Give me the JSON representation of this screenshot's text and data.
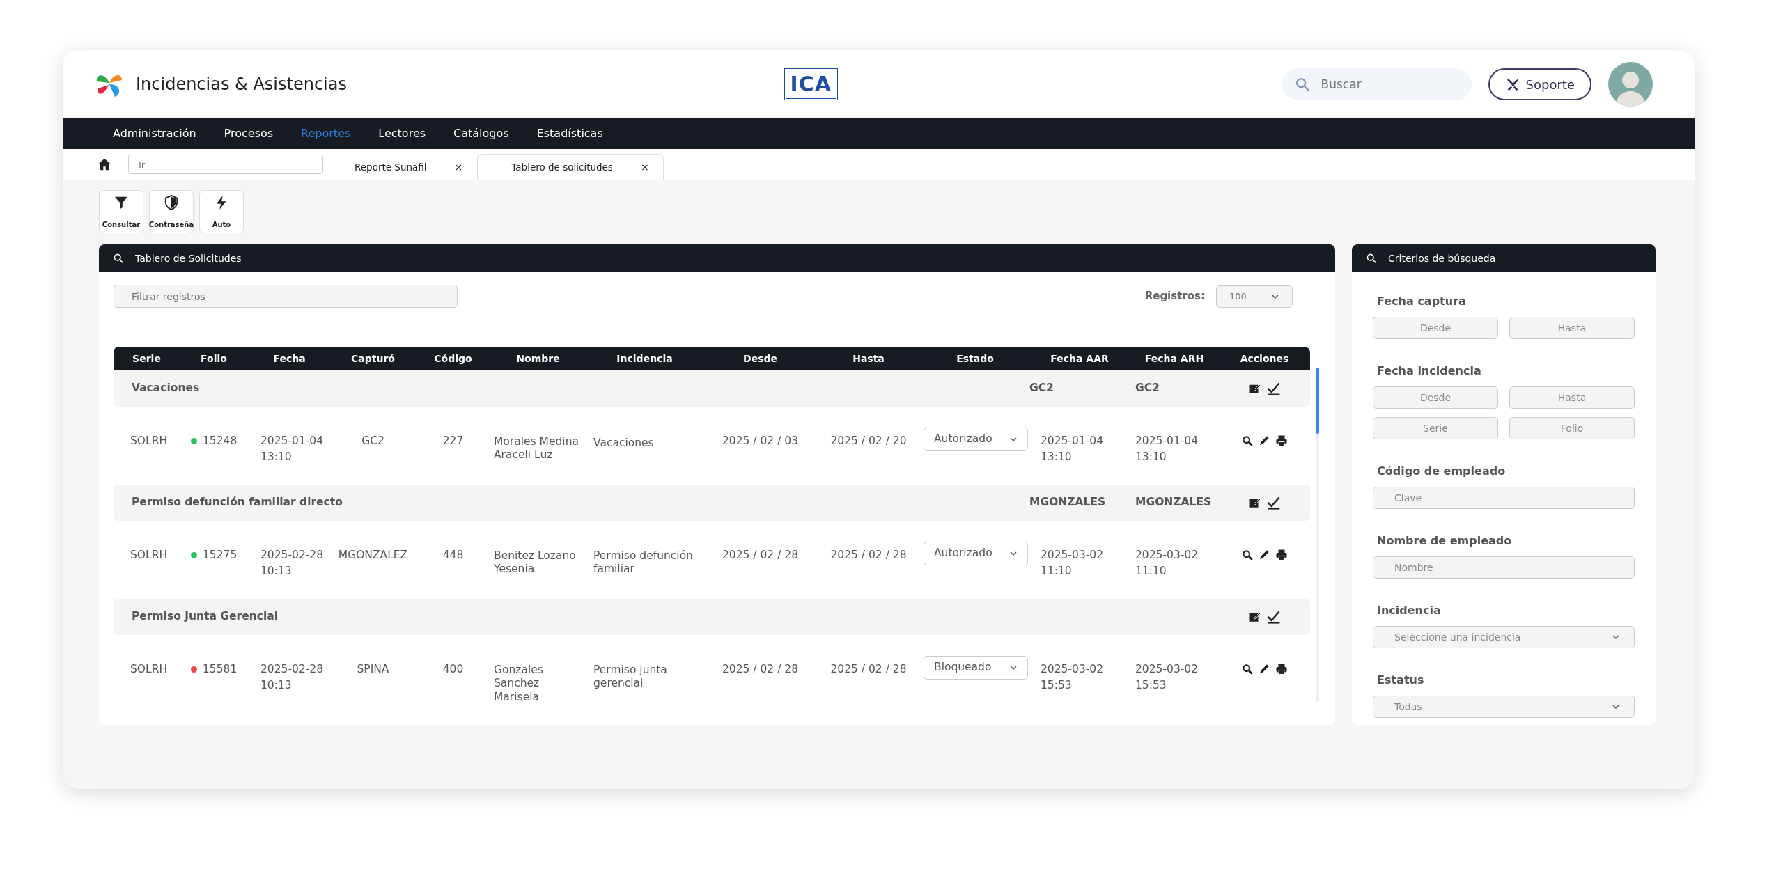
{
  "app": {
    "title": "Incidencias & Asistencias",
    "logo_text": "ICA",
    "search": {
      "placeholder": "Buscar"
    },
    "support_button": "Soporte"
  },
  "menu": [
    {
      "label": "Administración",
      "selected": false
    },
    {
      "label": "Procesos",
      "selected": false
    },
    {
      "label": "Reportes",
      "selected": true
    },
    {
      "label": "Lectores",
      "selected": false
    },
    {
      "label": "Catálogos",
      "selected": false
    },
    {
      "label": "Estadísticas",
      "selected": false
    }
  ],
  "tabbar": {
    "go_field": {
      "placeholder": "Ir"
    },
    "tabs": [
      {
        "label": "Reporte Sunafil",
        "close": "×",
        "selected": false
      },
      {
        "label": "Tablero de solicitudes",
        "close": "×",
        "selected": true
      }
    ]
  },
  "toolbar": [
    {
      "kind": "funnel",
      "label": "Consultar"
    },
    {
      "kind": "shield",
      "label": "Contraseña"
    },
    {
      "kind": "bolt",
      "label": "Auto"
    }
  ],
  "main_panel": {
    "title": "Tablero de Solicitudes",
    "filter": {
      "placeholder": "Filtrar registros"
    },
    "records_label": "Registros:",
    "records_value": "100",
    "table": {
      "columns": [
        "Serie",
        "Folio",
        "Fecha",
        "Capturó",
        "Código",
        "Nombre",
        "Incidencia",
        "Desde",
        "Hasta",
        "Estado",
        "Fecha AAR",
        "Fecha ARH",
        "Acciones"
      ],
      "groups": [
        {
          "title": "Vacaciones",
          "fecha_aar": "GC2",
          "fecha_arh": "GC2",
          "rows": [
            {
              "serie": "SOLRH",
              "folio": "15248",
              "color": "#22c55e",
              "fecha": "2025-01-04 13:10",
              "capturo": "GC2",
              "codigo": "227",
              "nombre": "Morales Medina Araceli Luz",
              "incidencia": "Vacaciones",
              "desde": "2025 / 02 / 03",
              "hasta": "2025 / 02 / 20",
              "estado": "Autorizado",
              "fecha_aar": "2025-01-04 13:10",
              "fecha_arh": "2025-01-04 13:10"
            }
          ]
        },
        {
          "title": "Permiso defunción familiar directo",
          "fecha_aar": "MGONZALES",
          "fecha_arh": "MGONZALES",
          "rows": [
            {
              "serie": "SOLRH",
              "folio": "15275",
              "color": "#22c55e",
              "fecha": "2025-02-28 10:13",
              "capturo": "MGONZALEZ",
              "codigo": "448",
              "nombre": "Benitez Lozano Yesenia",
              "incidencia": "Permiso defunción familiar",
              "desde": "2025 / 02 / 28",
              "hasta": "2025 / 02 / 28",
              "estado": "Autorizado",
              "fecha_aar": "2025-03-02 11:10",
              "fecha_arh": "2025-03-02 11:10"
            }
          ]
        },
        {
          "title": "Permiso Junta Gerencial",
          "rows": [
            {
              "serie": "SOLRH",
              "folio": "15581",
              "color": "#ef4444",
              "fecha": "2025-02-28 10:13",
              "capturo": "SPINA",
              "codigo": "400",
              "nombre": "Gonzales Sanchez Marisela",
              "incidencia": "Permiso junta gerencial",
              "desde": "2025 / 02 / 28",
              "hasta": "2025 / 02 / 28",
              "estado": "Bloqueado",
              "fecha_aar": "2025-03-02 15:53",
              "fecha_arh": "2025-03-02 15:53"
            }
          ]
        }
      ]
    }
  },
  "criteria_panel": {
    "title": "Criterios de búsqueda",
    "sections": [
      {
        "label": "Fecha captura",
        "fields": [
          {
            "kind": "input",
            "placeholder": "Desde"
          },
          {
            "kind": "input",
            "placeholder": "Hasta"
          }
        ]
      },
      {
        "label": "Fecha incidencia",
        "fields": [
          {
            "kind": "input",
            "placeholder": "Desde"
          },
          {
            "kind": "input",
            "placeholder": "Hasta"
          },
          {
            "kind": "input",
            "placeholder": "Serie"
          },
          {
            "kind": "input",
            "placeholder": "Folio"
          }
        ]
      },
      {
        "label": "Código de empleado",
        "fields": [
          {
            "kind": "wide",
            "placeholder": "Clave"
          }
        ]
      },
      {
        "label": "Nombre de empleado",
        "fields": [
          {
            "kind": "wide",
            "placeholder": "Nombre"
          }
        ]
      },
      {
        "label": "Incidencia",
        "fields": [
          {
            "kind": "select",
            "value": "Seleccione una incidencia"
          }
        ]
      },
      {
        "label": "Estatus",
        "fields": [
          {
            "kind": "select",
            "value": "Todas"
          }
        ]
      }
    ]
  }
}
